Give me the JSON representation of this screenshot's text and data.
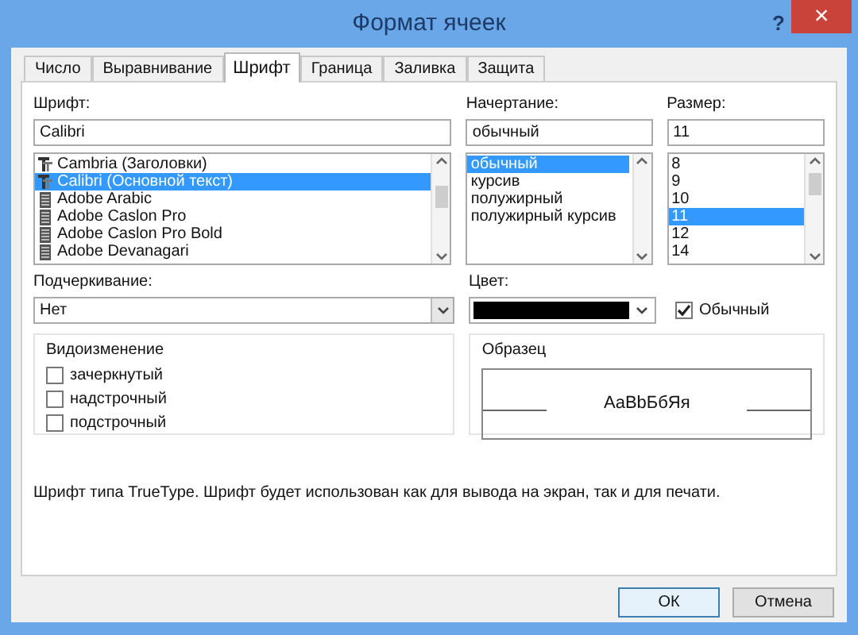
{
  "window": {
    "title": "Формат ячеек",
    "help": "?",
    "close": "×"
  },
  "tabs": [
    {
      "label": "Число",
      "selected": false
    },
    {
      "label": "Выравнивание",
      "selected": false
    },
    {
      "label": "Шрифт",
      "selected": true
    },
    {
      "label": "Граница",
      "selected": false
    },
    {
      "label": "Заливка",
      "selected": false
    },
    {
      "label": "Защита",
      "selected": false
    }
  ],
  "font": {
    "label": "Шрифт:",
    "value": "Calibri",
    "items": [
      {
        "label": "Cambria (Заголовки)",
        "kind": "truetype",
        "selected": false
      },
      {
        "label": "Calibri (Основной текст)",
        "kind": "truetype",
        "selected": true
      },
      {
        "label": "Adobe Arabic",
        "kind": "opentype",
        "selected": false
      },
      {
        "label": "Adobe Caslon Pro",
        "kind": "opentype",
        "selected": false
      },
      {
        "label": "Adobe Caslon Pro Bold",
        "kind": "opentype",
        "selected": false
      },
      {
        "label": "Adobe Devanagari",
        "kind": "opentype",
        "selected": false
      }
    ]
  },
  "style": {
    "label": "Начертание:",
    "value": "обычный",
    "items": [
      {
        "label": "обычный",
        "selected": true
      },
      {
        "label": "курсив",
        "selected": false
      },
      {
        "label": "полужирный",
        "selected": false
      },
      {
        "label": "полужирный курсив",
        "selected": false
      }
    ]
  },
  "size": {
    "label": "Размер:",
    "value": "11",
    "items": [
      {
        "label": "8",
        "selected": false
      },
      {
        "label": "9",
        "selected": false
      },
      {
        "label": "10",
        "selected": false
      },
      {
        "label": "11",
        "selected": true
      },
      {
        "label": "12",
        "selected": false
      },
      {
        "label": "14",
        "selected": false
      }
    ]
  },
  "underline": {
    "label": "Подчеркивание:",
    "value": "Нет"
  },
  "color": {
    "label": "Цвет:",
    "color": "#000000",
    "normal": {
      "label": "Обычный",
      "checked": true
    }
  },
  "effects": {
    "title": "Видоизменение",
    "items": [
      {
        "label": "зачеркнутый",
        "checked": false
      },
      {
        "label": "надстрочный",
        "checked": false
      },
      {
        "label": "подстрочный",
        "checked": false
      }
    ]
  },
  "preview": {
    "title": "Образец",
    "sample": "AaBbБбЯя"
  },
  "description": "Шрифт типа TrueType. Шрифт будет использован как для вывода на экран, так и для печати.",
  "buttons": [
    {
      "label": "ОК",
      "default": true
    },
    {
      "label": "Отмена",
      "default": false
    }
  ]
}
